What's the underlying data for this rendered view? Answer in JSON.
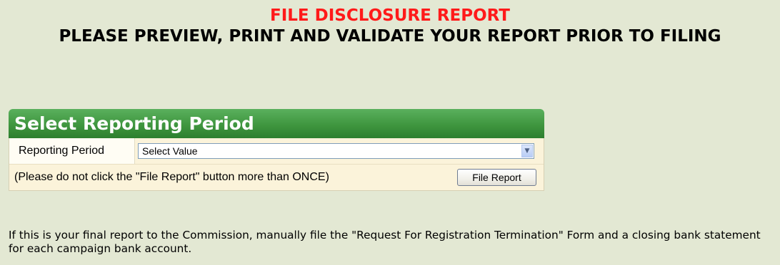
{
  "header": {
    "title": "FILE DISCLOSURE REPORT",
    "subtitle": "PLEASE PREVIEW, PRINT AND VALIDATE YOUR REPORT PRIOR TO FILING"
  },
  "panel": {
    "title": "Select Reporting Period",
    "period_label": "Reporting Period",
    "period_select_value": "Select Value",
    "note": "(Please do not click the \"File Report\" button more than ONCE)",
    "file_report_button": "File Report"
  },
  "footer": {
    "text": "If this is your final report to the Commission, manually file the \"Request For Registration Termination\" Form and a closing bank statement for each campaign bank account."
  },
  "icons": {
    "select_arrow": "chevron-down-icon"
  },
  "colors": {
    "background": "#e3e8d3",
    "title_red": "#ff1a1a",
    "panel_header_green": "#3f963f",
    "panel_body": "#fbf3da"
  }
}
